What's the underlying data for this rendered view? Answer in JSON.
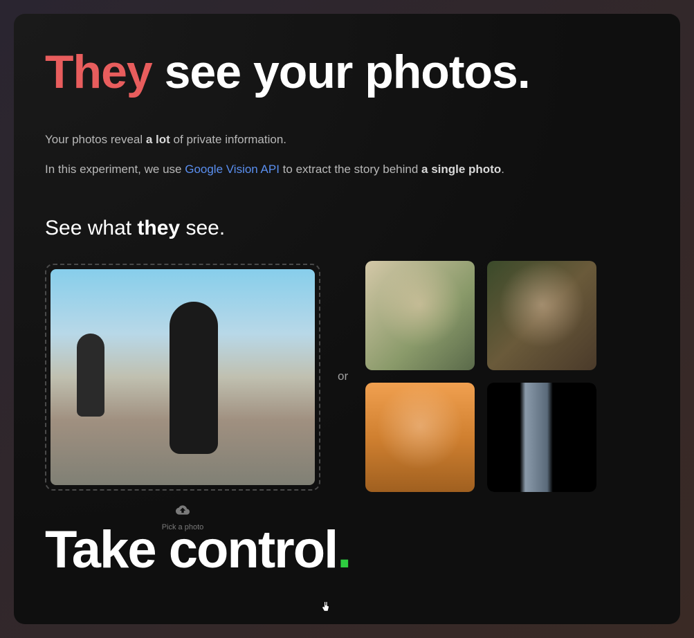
{
  "main_title": {
    "accent": "They",
    "rest": " see your photos."
  },
  "description": {
    "line1_pre": "Your photos reveal ",
    "line1_strong": "a lot",
    "line1_post": " of private information.",
    "line2_pre": "In this experiment, we use ",
    "line2_link": "Google Vision API",
    "line2_mid": " to extract the story behind ",
    "line2_strong": "a single photo",
    "line2_post": "."
  },
  "subtitle": {
    "pre": "See what ",
    "strong": "they",
    "post": " see."
  },
  "or_text": "or",
  "upload_button": "Pick a photo",
  "bottom_title": {
    "text": "Take control",
    "dot": "."
  },
  "colors": {
    "accent_red": "#e85d5d",
    "link_blue": "#5a8ff0",
    "dot_green": "#2ecc40"
  }
}
